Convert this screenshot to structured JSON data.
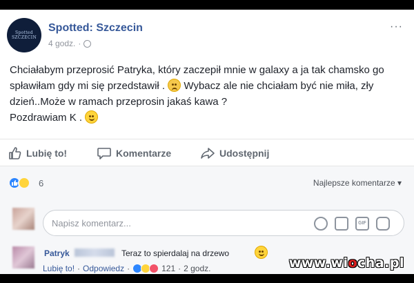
{
  "post": {
    "page_name": "Spotted: Szczecin",
    "page_logo_text": "Spotted SZCZECIN",
    "time": "4 godz.",
    "separator": "·",
    "more": "···",
    "text_part1": "Chciałabym przeprosić Patryka, który zaczepił mnie w galaxy a ja tak chamsko go spławiłam gdy mi się przedstawił .",
    "text_part2": "Wybacz ale nie chciałam być nie miła, zły dzień..Może w ramach przeprosin jakaś kawa ?",
    "text_part3": "Pozdrawiam K .",
    "emoji_sad": "disappointed-face-emoji",
    "emoji_smile": "smiling-face-emoji"
  },
  "actions": {
    "like": "Lubię to!",
    "comment": "Komentarze",
    "share": "Udostępnij"
  },
  "reactions": {
    "count": "6",
    "types": [
      "like",
      "haha"
    ],
    "sort": "Najlepsze komentarze ▾"
  },
  "composer": {
    "placeholder": "Napisz komentarz...",
    "icons": [
      "emoji-icon",
      "camera-icon",
      "gif-icon",
      "sticker-icon"
    ]
  },
  "comment": {
    "author": "Patryk",
    "text": "Teraz to spierdalaj na drzewo",
    "like": "Lubię to!",
    "reply": "Odpowiedz",
    "dot": "·",
    "reaction_count": "121",
    "time": "2 godz."
  },
  "watermark": {
    "prefix": "www.wi",
    "accent": "o",
    "suffix": "cha.pl"
  },
  "colors": {
    "link_blue": "#365899",
    "like_blue": "#2d86ff",
    "grey_text": "#606770",
    "background": "#f6f7f9"
  }
}
